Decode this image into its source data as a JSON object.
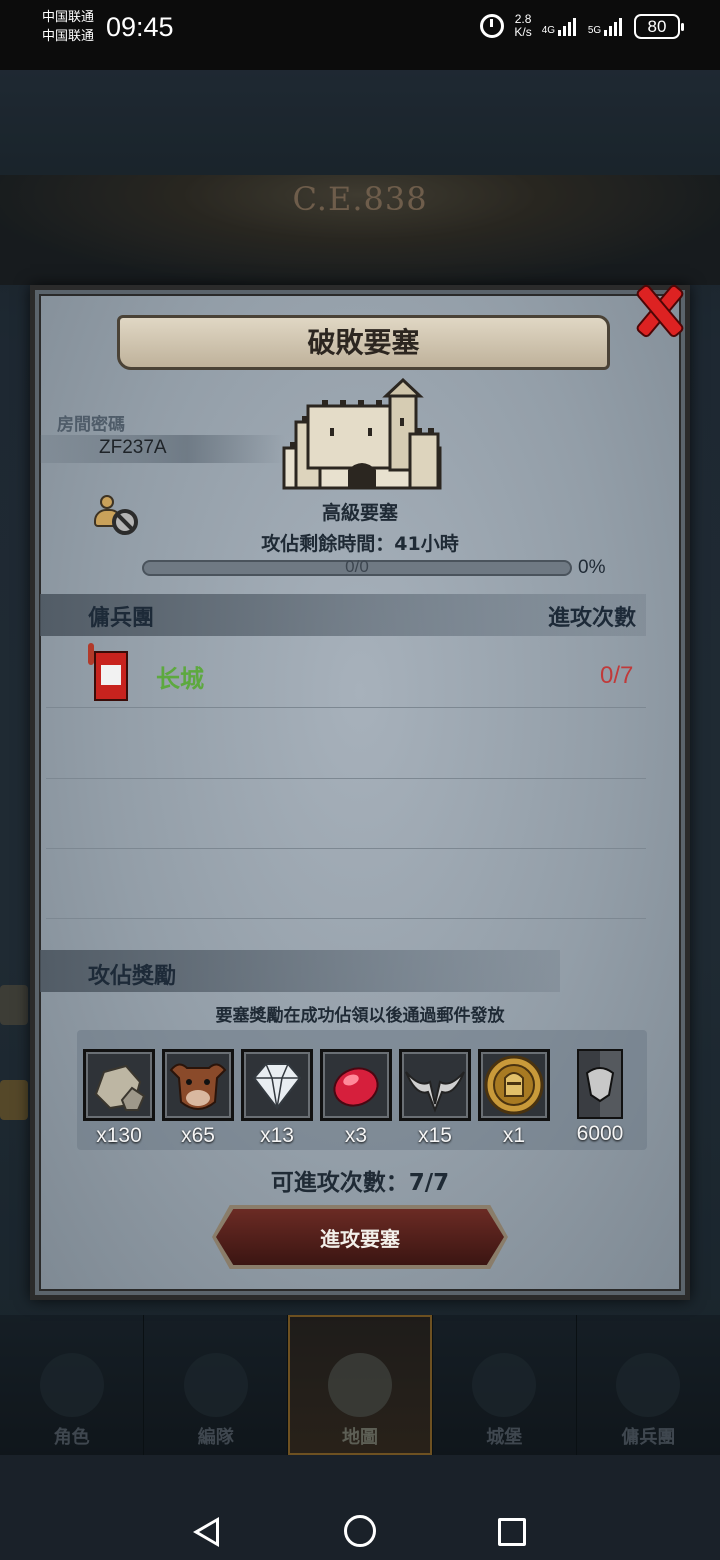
{
  "status_bar": {
    "carrier_1": "中国联通",
    "carrier_2": "中国联通",
    "time": "09:45",
    "speed_value": "2.8",
    "speed_unit": "K/s",
    "network_1": "4G",
    "network_2": "5G",
    "battery": "80"
  },
  "background": {
    "era": "C.E.838"
  },
  "modal": {
    "title": "破敗要塞",
    "room_label": "房間密碼",
    "room_code": "ZF237A",
    "fort_level": "高級要塞",
    "time_remaining": "攻佔剩餘時間：41小時",
    "progress_text": "0/0",
    "progress_percent": "0%",
    "progress_fraction": 0,
    "guild_section": {
      "title": "傭兵團",
      "right_label": "進攻次數"
    },
    "guilds": [
      {
        "name": "长城",
        "attacks": "0/7"
      }
    ],
    "reward_section": {
      "title": "攻佔獎勵",
      "note": "要塞獎勵在成功佔領以後通過郵件發放"
    },
    "rewards": [
      {
        "icon": "stone-icon",
        "qty": "x130"
      },
      {
        "icon": "bull-head-icon",
        "qty": "x65"
      },
      {
        "icon": "diamond-icon",
        "qty": "x13"
      },
      {
        "icon": "ruby-gem-icon",
        "qty": "x3"
      },
      {
        "icon": "horned-helm-icon",
        "qty": "x15"
      },
      {
        "icon": "gold-knight-medal-icon",
        "qty": "x1"
      },
      {
        "icon": "guild-banner-icon",
        "qty": "6000"
      }
    ],
    "attacks_left": "可進攻次數：7/7",
    "attack_button": "進攻要塞"
  },
  "bottom_nav": {
    "items": [
      {
        "label": "角色",
        "icon": "knight-icon"
      },
      {
        "label": "編隊",
        "icon": "shield-icon"
      },
      {
        "label": "地圖",
        "icon": "globe-icon",
        "active": true
      },
      {
        "label": "城堡",
        "icon": "castle-icon"
      },
      {
        "label": "傭兵團",
        "icon": "horse-banner-icon"
      }
    ]
  },
  "colors": {
    "guild_name": "#5da93f",
    "attacks_count": "#c03a3a",
    "close_x": "#dd2222",
    "attack_button": "#6b2b24"
  }
}
